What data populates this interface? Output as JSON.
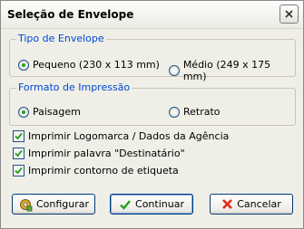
{
  "window": {
    "title": "Seleção de Envelope",
    "close_icon": "close-icon"
  },
  "envelope_group": {
    "legend": "Tipo de Envelope",
    "options": [
      {
        "label": "Pequeno (230 x 113 mm)",
        "selected": true
      },
      {
        "label": "Médio (249 x 175 mm)",
        "selected": false
      }
    ]
  },
  "print_format_group": {
    "legend": "Formato de Impressão",
    "options": [
      {
        "label": "Paisagem",
        "selected": true
      },
      {
        "label": "Retrato",
        "selected": false
      }
    ]
  },
  "checkboxes": [
    {
      "label": "Imprimir Logomarca / Dados da Agência",
      "checked": true
    },
    {
      "label": "Imprimir palavra \"Destinatário\"",
      "checked": true
    },
    {
      "label": "Imprimir contorno de etiqueta",
      "checked": true
    }
  ],
  "buttons": {
    "configure": {
      "label": "Configurar",
      "icon": "gear-icon"
    },
    "continue": {
      "label": "Continuar",
      "icon": "check-icon"
    },
    "cancel": {
      "label": "Cancelar",
      "icon": "x-icon"
    }
  },
  "colors": {
    "legend": "#0046d5",
    "radio_dot": "#21a121",
    "check": "#21a121",
    "cancel_icon": "#e02a1a"
  }
}
